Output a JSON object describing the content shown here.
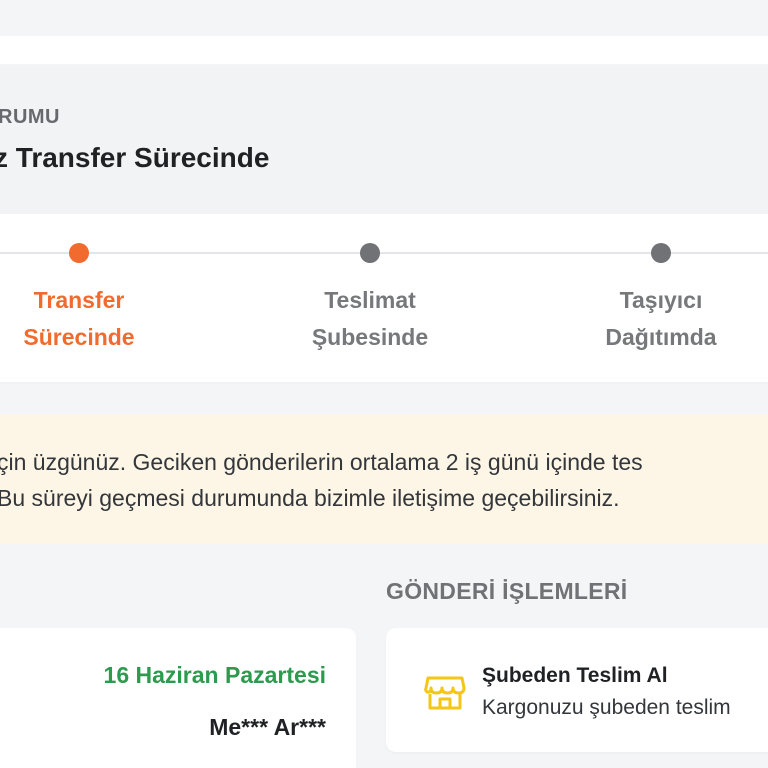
{
  "status": {
    "label": "RUMU",
    "title": "z Transfer Sürecinde"
  },
  "steps": [
    {
      "label_line1": "Transfer",
      "label_line2": "Sürecinde",
      "active": true
    },
    {
      "label_line1": "Teslimat",
      "label_line2": "Şubesinde",
      "active": false
    },
    {
      "label_line1": "Taşıyıcı",
      "label_line2": "Dağıtımda",
      "active": false
    }
  ],
  "notice": {
    "line1": "çin üzgünüz. Geciken gönderilerin ortalama 2 iş günü içinde tes",
    "line2": "Bu süreyi geçmesi durumunda bizimle iletişime geçebilirsiniz."
  },
  "delivery": {
    "date": "16 Haziran Pazartesi",
    "recipient": "Me*** Ar***"
  },
  "actions": {
    "section_title": "GÖNDERİ İŞLEMLERİ",
    "items": [
      {
        "title": "Şubeden Teslim Al",
        "description": "Kargonuzu şubeden teslim",
        "icon": "store-icon"
      }
    ]
  },
  "colors": {
    "accent": "#f26b2e",
    "success": "#2c9a4f",
    "notice_bg": "#fdf6e6",
    "icon_yellow": "#f5c518"
  }
}
